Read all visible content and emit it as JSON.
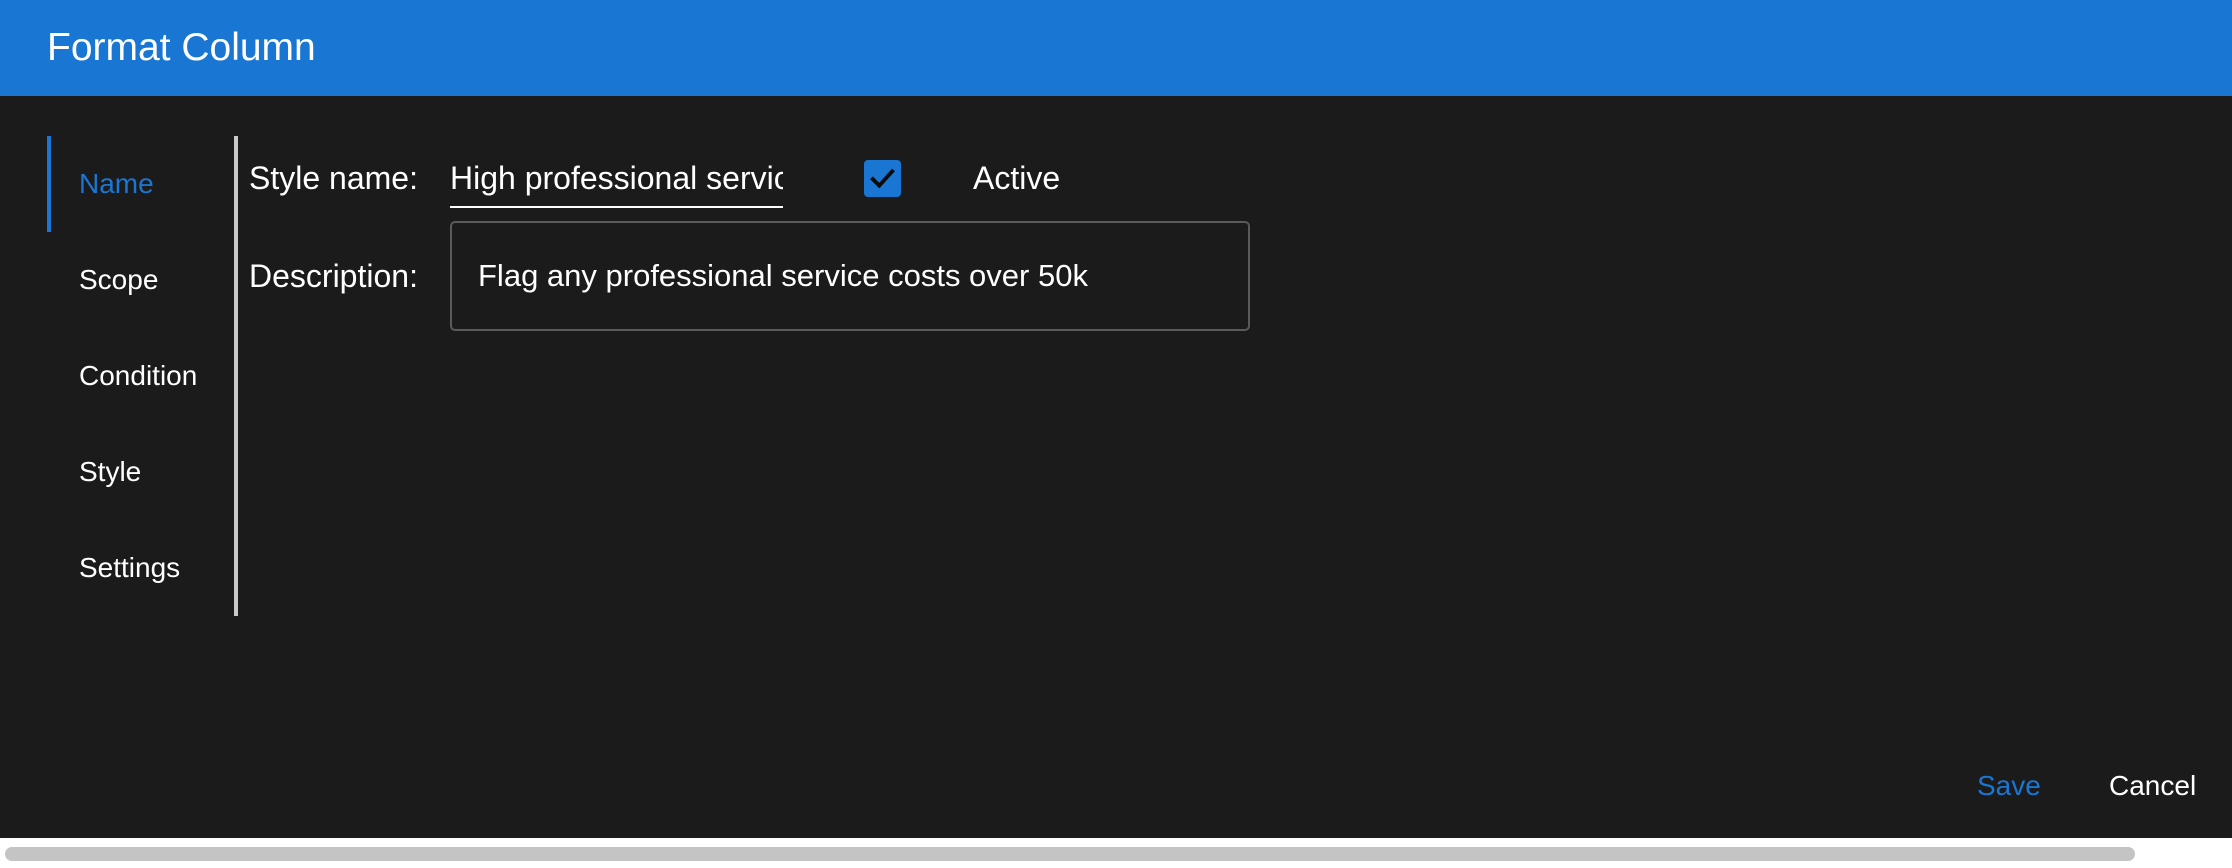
{
  "dialog": {
    "title": "Format Column"
  },
  "nav": {
    "items": [
      {
        "label": "Name",
        "active": true
      },
      {
        "label": "Scope",
        "active": false
      },
      {
        "label": "Condition",
        "active": false
      },
      {
        "label": "Style",
        "active": false
      },
      {
        "label": "Settings",
        "active": false
      }
    ]
  },
  "form": {
    "style_name_label": "Style name:",
    "style_name_value": "High professional servic",
    "active_label": "Active",
    "active_checked": true,
    "description_label": "Description:",
    "description_value": "Flag any professional service costs over 50k"
  },
  "footer": {
    "save_label": "Save",
    "cancel_label": "Cancel"
  },
  "colors": {
    "accent": "#1976d2",
    "background": "#1b1b1c",
    "text": "#ffffff"
  },
  "icons": {
    "checkbox": "check-icon"
  }
}
